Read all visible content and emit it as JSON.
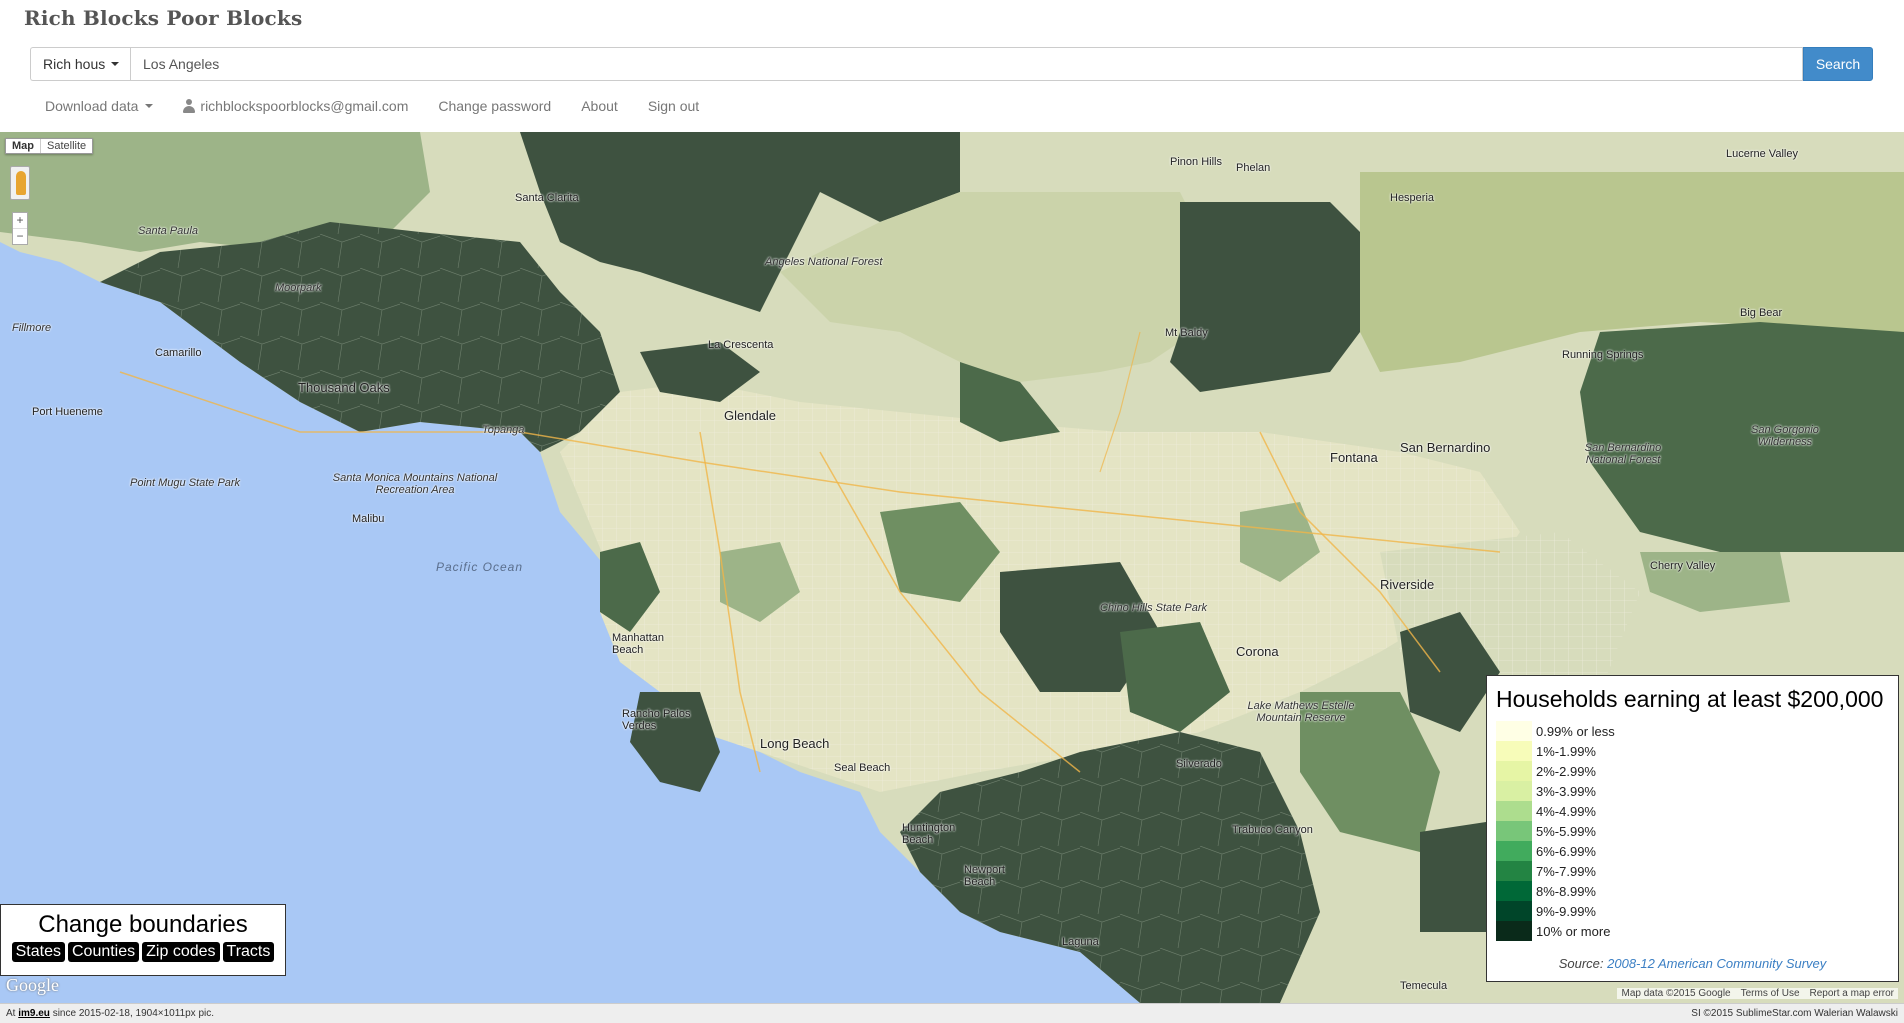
{
  "app": {
    "brand": "Rich Blocks Poor Blocks"
  },
  "search": {
    "dropdown_label": "Rich hous",
    "query": "Los Angeles",
    "button_label": "Search"
  },
  "nav": {
    "download": "Download data",
    "email": "richblockspoorblocks@gmail.com",
    "change_password": "Change password",
    "about": "About",
    "sign_out": "Sign out"
  },
  "map": {
    "type_map": "Map",
    "type_satellite": "Satellite",
    "zoom_in": "+",
    "zoom_out": "−",
    "labels": {
      "pacific_ocean": "Pacific Ocean",
      "point_mugu": "Point Mugu State Park",
      "port_hueneme": "Port Hueneme",
      "angeles_forest": "Angeles National Forest",
      "thousand_oaks": "Thousand Oaks",
      "santa_monica_mtns": "Santa Monica Mountains National Recreation Area",
      "malibu": "Malibu",
      "topanga": "Topanga",
      "glendale": "Glendale",
      "la_crescenta": "La Crescenta",
      "pinon_hills": "Pinon Hills",
      "phelan": "Phelan",
      "hesperia": "Hesperia",
      "mt_baldy": "Mt Baldy",
      "fontana": "Fontana",
      "san_bernardino": "San Bernardino",
      "sb_forest": "San Bernardino National Forest",
      "san_gorgonio": "San Gorgonio Wilderness",
      "cherry_valley": "Cherry Valley",
      "riverside": "Riverside",
      "corona": "Corona",
      "chino_hills": "Chino Hills State Park",
      "lake_mathews": "Lake Mathews Estelle Mountain Reserve",
      "silverado": "Silverado",
      "long_beach": "Long Beach",
      "seal_beach": "Seal Beach",
      "palos_verdes": "Rancho Palos Verdes",
      "manhattan_beach": "Manhattan Beach",
      "huntington_beach": "Huntington Beach",
      "newport_beach": "Newport Beach",
      "laguna": "Laguna",
      "santa_paula": "Santa Paula",
      "fillmore": "Fillmore",
      "camarillo": "Camarillo",
      "moorpark": "Moorpark",
      "santa_clarita": "Santa Clarita",
      "running_springs": "Running Springs",
      "big_bear": "Big Bear",
      "temecula": "Temecula",
      "trabuco": "Trabuco Canyon",
      "lucerne": "Lucerne Valley"
    }
  },
  "boundaries": {
    "title": "Change boundaries",
    "states": "States",
    "counties": "Counties",
    "zip_codes": "Zip codes",
    "tracts": "Tracts"
  },
  "legend": {
    "title": "Households earning at least $200,000",
    "items": [
      {
        "label": "0.99% or less",
        "color": "#ffffe5"
      },
      {
        "label": "1%-1.99%",
        "color": "#f7fcb9"
      },
      {
        "label": "2%-2.99%",
        "color": "#e6f5a5"
      },
      {
        "label": "3%-3.99%",
        "color": "#d9f0a3"
      },
      {
        "label": "4%-4.99%",
        "color": "#addd8e"
      },
      {
        "label": "5%-5.99%",
        "color": "#78c679"
      },
      {
        "label": "6%-6.99%",
        "color": "#41ab5d"
      },
      {
        "label": "7%-7.99%",
        "color": "#238443"
      },
      {
        "label": "8%-8.99%",
        "color": "#006837"
      },
      {
        "label": "9%-9.99%",
        "color": "#004529"
      },
      {
        "label": "10% or more",
        "color": "#0a2a1a"
      }
    ],
    "source_prefix": "Source:",
    "source_link": "2008-12 American Community Survey"
  },
  "google": {
    "logo": "Google"
  },
  "attribution": {
    "map_data": "Map data ©2015 Google",
    "terms": "Terms of Use",
    "report": "Report a map error"
  },
  "footer": {
    "left_prefix": "At",
    "left_link": "im9.eu",
    "left_suffix": "since 2015-02-18, 1904×1011px pic.",
    "right": "SI ©2015 SublimeStar.com Walerian Walawski"
  },
  "colors": {
    "ocean": "#a9c8f5",
    "dark_green": "#3e5240",
    "mid_green": "#6f8f62",
    "light_land": "#d7dcbc",
    "search_button": "#428bca"
  }
}
